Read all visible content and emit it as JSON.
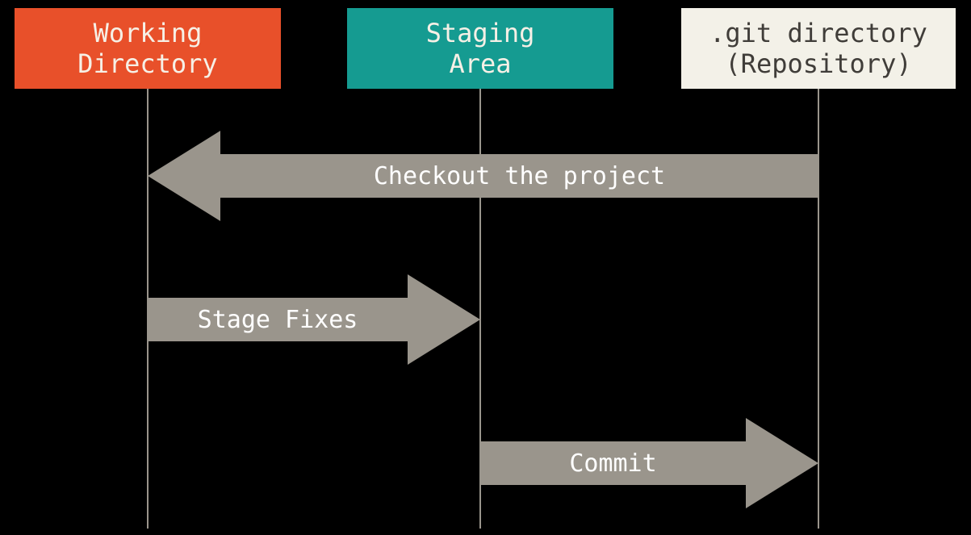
{
  "nodes": {
    "working": {
      "label": "Working\nDirectory",
      "color": "#e8502a"
    },
    "staging": {
      "label": "Staging\nArea",
      "color": "#159b91"
    },
    "git": {
      "label": ".git directory\n(Repository)",
      "color": "#f3f1e8"
    }
  },
  "arrows": {
    "checkout": {
      "label": "Checkout the project",
      "from": "git",
      "to": "working",
      "direction": "left"
    },
    "stage": {
      "label": "Stage Fixes",
      "from": "working",
      "to": "staging",
      "direction": "right"
    },
    "commit": {
      "label": "Commit",
      "from": "staging",
      "to": "git",
      "direction": "right"
    }
  }
}
